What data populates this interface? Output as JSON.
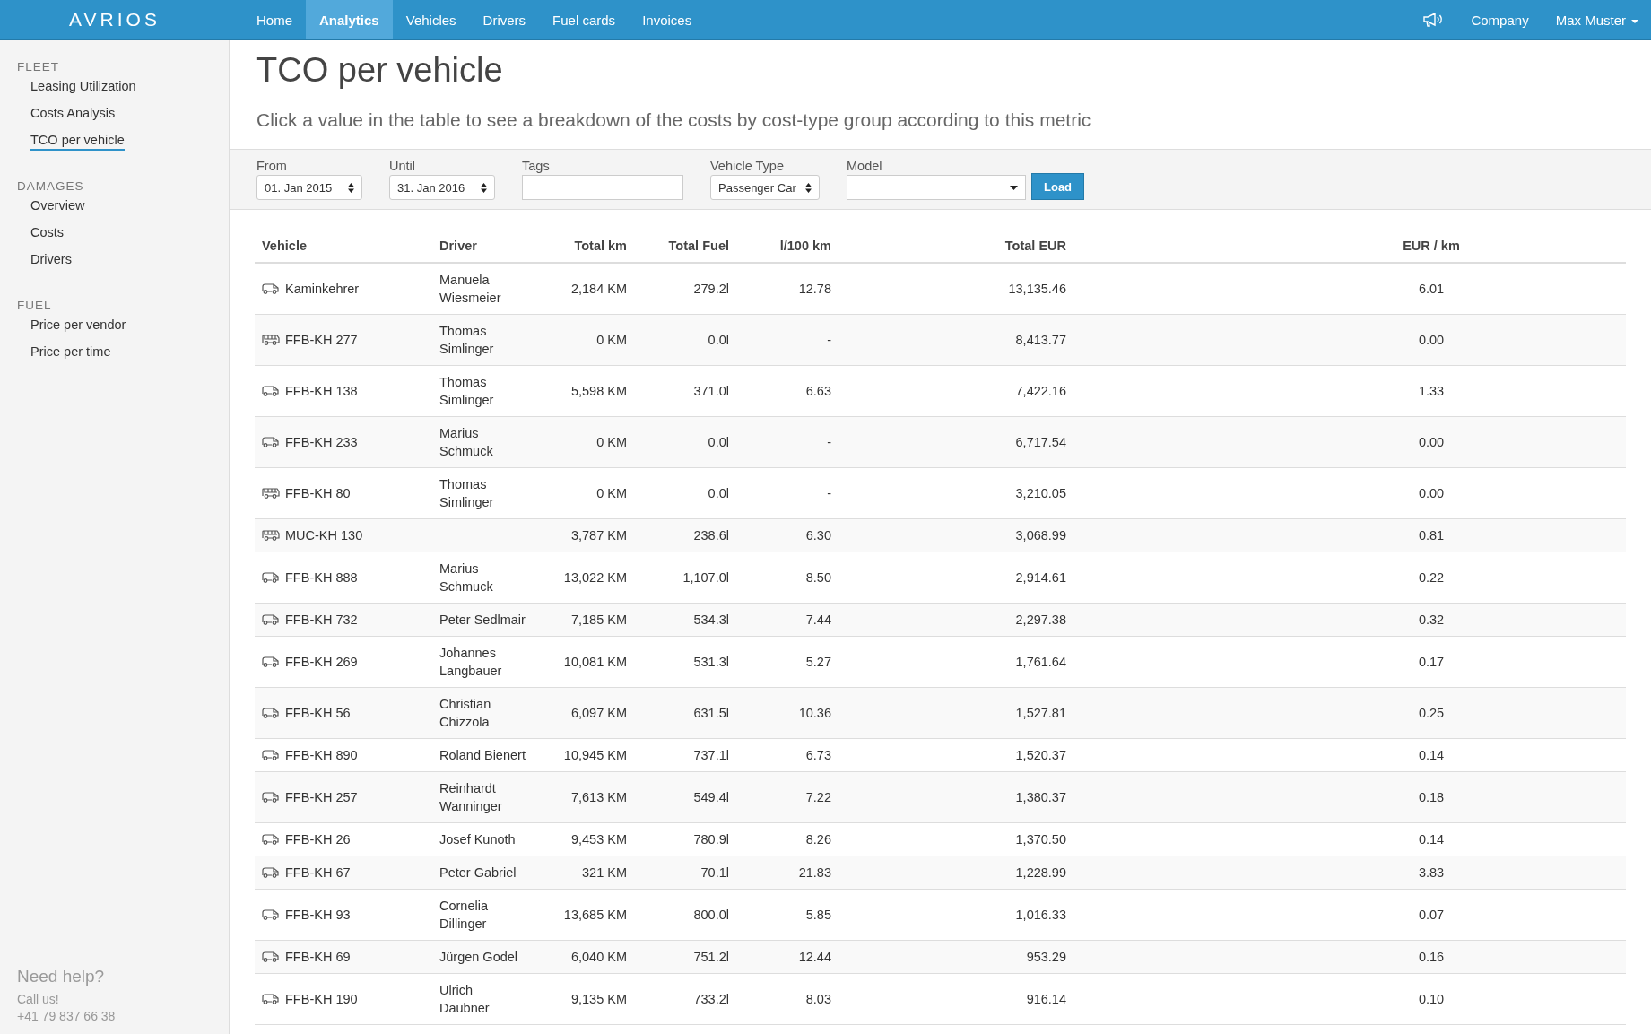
{
  "brand": "AVRIOS",
  "nav": [
    {
      "label": "Home",
      "selected": false
    },
    {
      "label": "Analytics",
      "selected": true
    },
    {
      "label": "Vehicles",
      "selected": false
    },
    {
      "label": "Drivers",
      "selected": false
    },
    {
      "label": "Fuel cards",
      "selected": false
    },
    {
      "label": "Invoices",
      "selected": false
    }
  ],
  "nav_right": {
    "company": "Company",
    "user": "Max Muster"
  },
  "sidebar": {
    "groups": [
      {
        "title": "FLEET",
        "items": [
          {
            "label": "Leasing Utilization",
            "selected": false
          },
          {
            "label": "Costs Analysis",
            "selected": false
          },
          {
            "label": "TCO per vehicle",
            "selected": true
          }
        ]
      },
      {
        "title": "DAMAGES",
        "items": [
          {
            "label": "Overview",
            "selected": false
          },
          {
            "label": "Costs",
            "selected": false
          },
          {
            "label": "Drivers",
            "selected": false
          }
        ]
      },
      {
        "title": "FUEL",
        "items": [
          {
            "label": "Price per vendor",
            "selected": false
          },
          {
            "label": "Price per time",
            "selected": false
          }
        ]
      }
    ],
    "help": {
      "title": "Need help?",
      "line": "Call us!",
      "phone": "+41 79 837 66 38"
    }
  },
  "page": {
    "title": "TCO per vehicle",
    "subtitle": "Click a value in the table to see a breakdown of the costs by cost-type group according to this metric"
  },
  "filters": [
    {
      "label": "From",
      "kind": "select",
      "value": "01. Jan 2015"
    },
    {
      "label": "Until",
      "kind": "select",
      "value": "31. Jan 2016"
    },
    {
      "label": "Tags",
      "kind": "text"
    },
    {
      "label": "Vehicle Type",
      "kind": "select",
      "value": "Passenger Car"
    },
    {
      "label": "Model",
      "kind": "dropdown"
    }
  ],
  "load_button": "Load",
  "table": {
    "columns": [
      "Vehicle",
      "Driver",
      "Total km",
      "Total Fuel",
      "l/100 km",
      "Total EUR",
      "EUR / km"
    ],
    "rows": [
      {
        "kind": "van",
        "vehicle": "Kaminkehrer",
        "driver": "Manuela Wiesmeier",
        "km": "2,184 KM",
        "fuel": "279.2l",
        "per100": "12.78",
        "eur": "13,135.46",
        "eur_km": "6.01"
      },
      {
        "kind": "bus",
        "vehicle": "FFB-KH 277",
        "driver": "Thomas Simlinger",
        "km": "0 KM",
        "fuel": "0.0l",
        "per100": "-",
        "eur": "8,413.77",
        "eur_km": "0.00"
      },
      {
        "kind": "van",
        "vehicle": "FFB-KH 138",
        "driver": "Thomas Simlinger",
        "km": "5,598 KM",
        "fuel": "371.0l",
        "per100": "6.63",
        "eur": "7,422.16",
        "eur_km": "1.33"
      },
      {
        "kind": "van",
        "vehicle": "FFB-KH 233",
        "driver": "Marius Schmuck",
        "km": "0 KM",
        "fuel": "0.0l",
        "per100": "-",
        "eur": "6,717.54",
        "eur_km": "0.00"
      },
      {
        "kind": "bus",
        "vehicle": "FFB-KH 80",
        "driver": "Thomas Simlinger",
        "km": "0 KM",
        "fuel": "0.0l",
        "per100": "-",
        "eur": "3,210.05",
        "eur_km": "0.00"
      },
      {
        "kind": "bus",
        "vehicle": "MUC-KH 130",
        "km": "3,787 KM",
        "fuel": "238.6l",
        "per100": "6.30",
        "eur": "3,068.99",
        "eur_km": "0.81"
      },
      {
        "kind": "van",
        "vehicle": "FFB-KH 888",
        "driver": "Marius Schmuck",
        "km": "13,022 KM",
        "fuel": "1,107.0l",
        "per100": "8.50",
        "eur": "2,914.61",
        "eur_km": "0.22"
      },
      {
        "kind": "van",
        "vehicle": "FFB-KH 732",
        "driver": "Peter Sedlmair",
        "km": "7,185 KM",
        "fuel": "534.3l",
        "per100": "7.44",
        "eur": "2,297.38",
        "eur_km": "0.32"
      },
      {
        "kind": "van",
        "vehicle": "FFB-KH 269",
        "driver": "Johannes Langbauer",
        "km": "10,081 KM",
        "fuel": "531.3l",
        "per100": "5.27",
        "eur": "1,761.64",
        "eur_km": "0.17"
      },
      {
        "kind": "van",
        "vehicle": "FFB-KH 56",
        "driver": "Christian Chizzola",
        "km": "6,097 KM",
        "fuel": "631.5l",
        "per100": "10.36",
        "eur": "1,527.81",
        "eur_km": "0.25"
      },
      {
        "kind": "van",
        "vehicle": "FFB-KH 890",
        "driver": "Roland Bienert",
        "km": "10,945 KM",
        "fuel": "737.1l",
        "per100": "6.73",
        "eur": "1,520.37",
        "eur_km": "0.14"
      },
      {
        "kind": "van",
        "vehicle": "FFB-KH 257",
        "driver": "Reinhardt Wanninger",
        "km": "7,613 KM",
        "fuel": "549.4l",
        "per100": "7.22",
        "eur": "1,380.37",
        "eur_km": "0.18"
      },
      {
        "kind": "van",
        "vehicle": "FFB-KH 26",
        "driver": "Josef Kunoth",
        "km": "9,453 KM",
        "fuel": "780.9l",
        "per100": "8.26",
        "eur": "1,370.50",
        "eur_km": "0.14"
      },
      {
        "kind": "van",
        "vehicle": "FFB-KH 67",
        "driver": "Peter Gabriel",
        "km": "321 KM",
        "fuel": "70.1l",
        "per100": "21.83",
        "eur": "1,228.99",
        "eur_km": "3.83"
      },
      {
        "kind": "van",
        "vehicle": "FFB-KH 93",
        "driver": "Cornelia Dillinger",
        "km": "13,685 KM",
        "fuel": "800.0l",
        "per100": "5.85",
        "eur": "1,016.33",
        "eur_km": "0.07"
      },
      {
        "kind": "van",
        "vehicle": "FFB-KH 69",
        "driver": "Jürgen Godel",
        "km": "6,040 KM",
        "fuel": "751.2l",
        "per100": "12.44",
        "eur": "953.29",
        "eur_km": "0.16"
      },
      {
        "kind": "van",
        "vehicle": "FFB-KH 190",
        "driver": "Ulrich Daubner",
        "km": "9,135 KM",
        "fuel": "733.2l",
        "per100": "8.03",
        "eur": "916.14",
        "eur_km": "0.10"
      }
    ]
  }
}
